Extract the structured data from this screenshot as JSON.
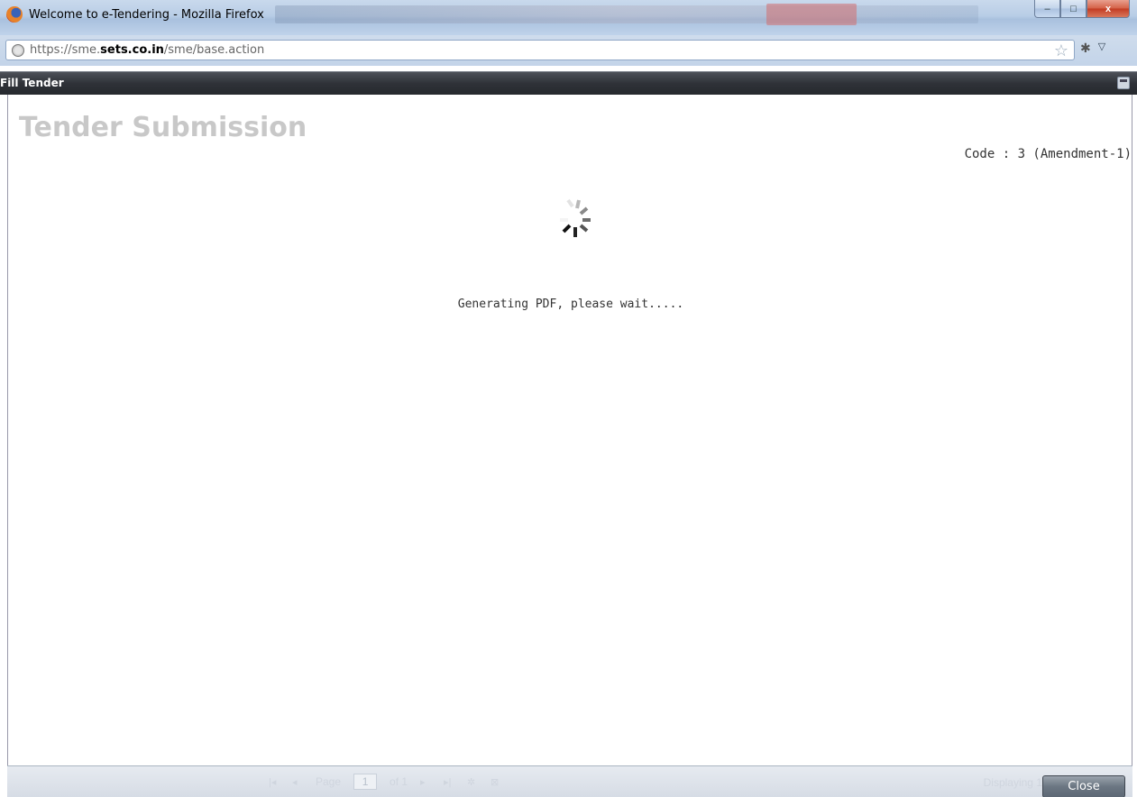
{
  "window": {
    "title": "Welcome to e-Tendering - Mozilla Firefox",
    "controls": {
      "minimize": "–",
      "maximize": "□",
      "close": "x"
    }
  },
  "browser": {
    "url_prefix": "https://sme.",
    "url_domain": "sets.co.in",
    "url_path": "/sme/base.action"
  },
  "dialog": {
    "title": "Fill Tender",
    "page_title": "Tender Submission",
    "code_label": "Code : 3 (Amendment-1)",
    "status_text": "Generating PDF, please wait.....",
    "close_label": "Close"
  },
  "pager": {
    "page_label": "Page",
    "page_value": "1",
    "of_label": "of 1",
    "displaying": "Displaying 1"
  }
}
